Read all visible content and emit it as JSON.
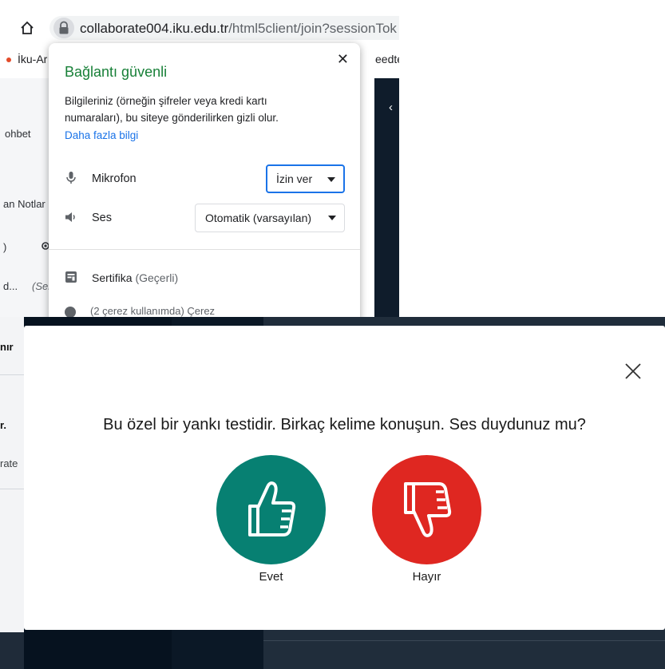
{
  "browser": {
    "url_host": "collaborate004.iku.edu.tr",
    "url_rest": "/html5client/join?sessionTok",
    "bookmarks": [
      "İku-Ar",
      "eedtest"
    ]
  },
  "background_app": {
    "sidebar": [
      "ohbet",
      "an Notlar",
      ")",
      "d...",
      "(Ser"
    ],
    "chevron": "‹"
  },
  "site_info_popup": {
    "title": "Bağlantı güvenli",
    "description": "Bilgileriniz (örneğin şifreler veya kredi kartı numaraları), bu siteye gönderilirken gizli olur.",
    "more_info_link": "Daha fazla bilgi",
    "permissions": [
      {
        "icon": "microphone-icon",
        "label": "Mikrofon",
        "value": "İzin ver"
      },
      {
        "icon": "speaker-icon",
        "label": "Ses",
        "value": "Otomatik (varsayılan)"
      }
    ],
    "certificate": {
      "label": "Sertifika",
      "state": "(Geçerli)"
    },
    "cookies_fragment": "(2 çerez kullanımda)  Çerez"
  },
  "bottom_background": {
    "fragments": [
      "nır",
      "r.",
      "rate"
    ]
  },
  "echo_test_dialog": {
    "question": "Bu özel bir yankı testidir. Birkaç kelime konuşun. Ses duydunuz mu?",
    "yes_label": "Evet",
    "no_label": "Hayır",
    "colors": {
      "yes": "#078072",
      "no": "#df2721"
    }
  }
}
